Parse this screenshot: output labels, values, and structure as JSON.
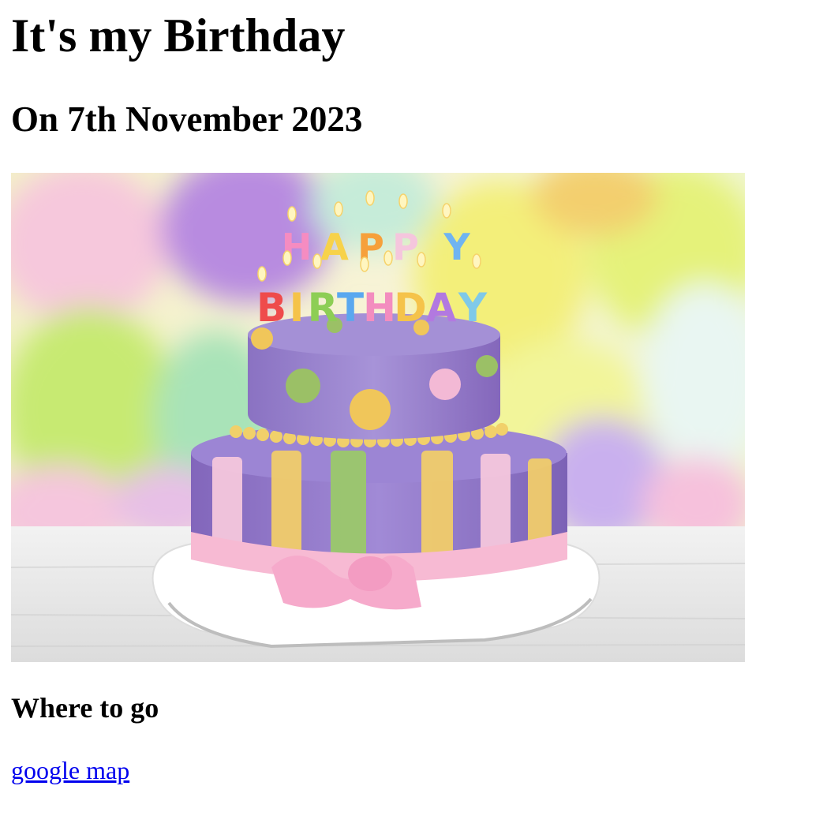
{
  "heading": "It's my Birthday",
  "subheading": "On 7th November 2023",
  "image": {
    "alt": "Birthday cake",
    "candle_text_top": "HAPPY",
    "candle_text_bottom": "BIRTHDAY"
  },
  "section_title": "Where to go",
  "link": {
    "label": "google map"
  },
  "colors": {
    "link": "#0000ee",
    "text": "#000000",
    "background": "#ffffff"
  }
}
